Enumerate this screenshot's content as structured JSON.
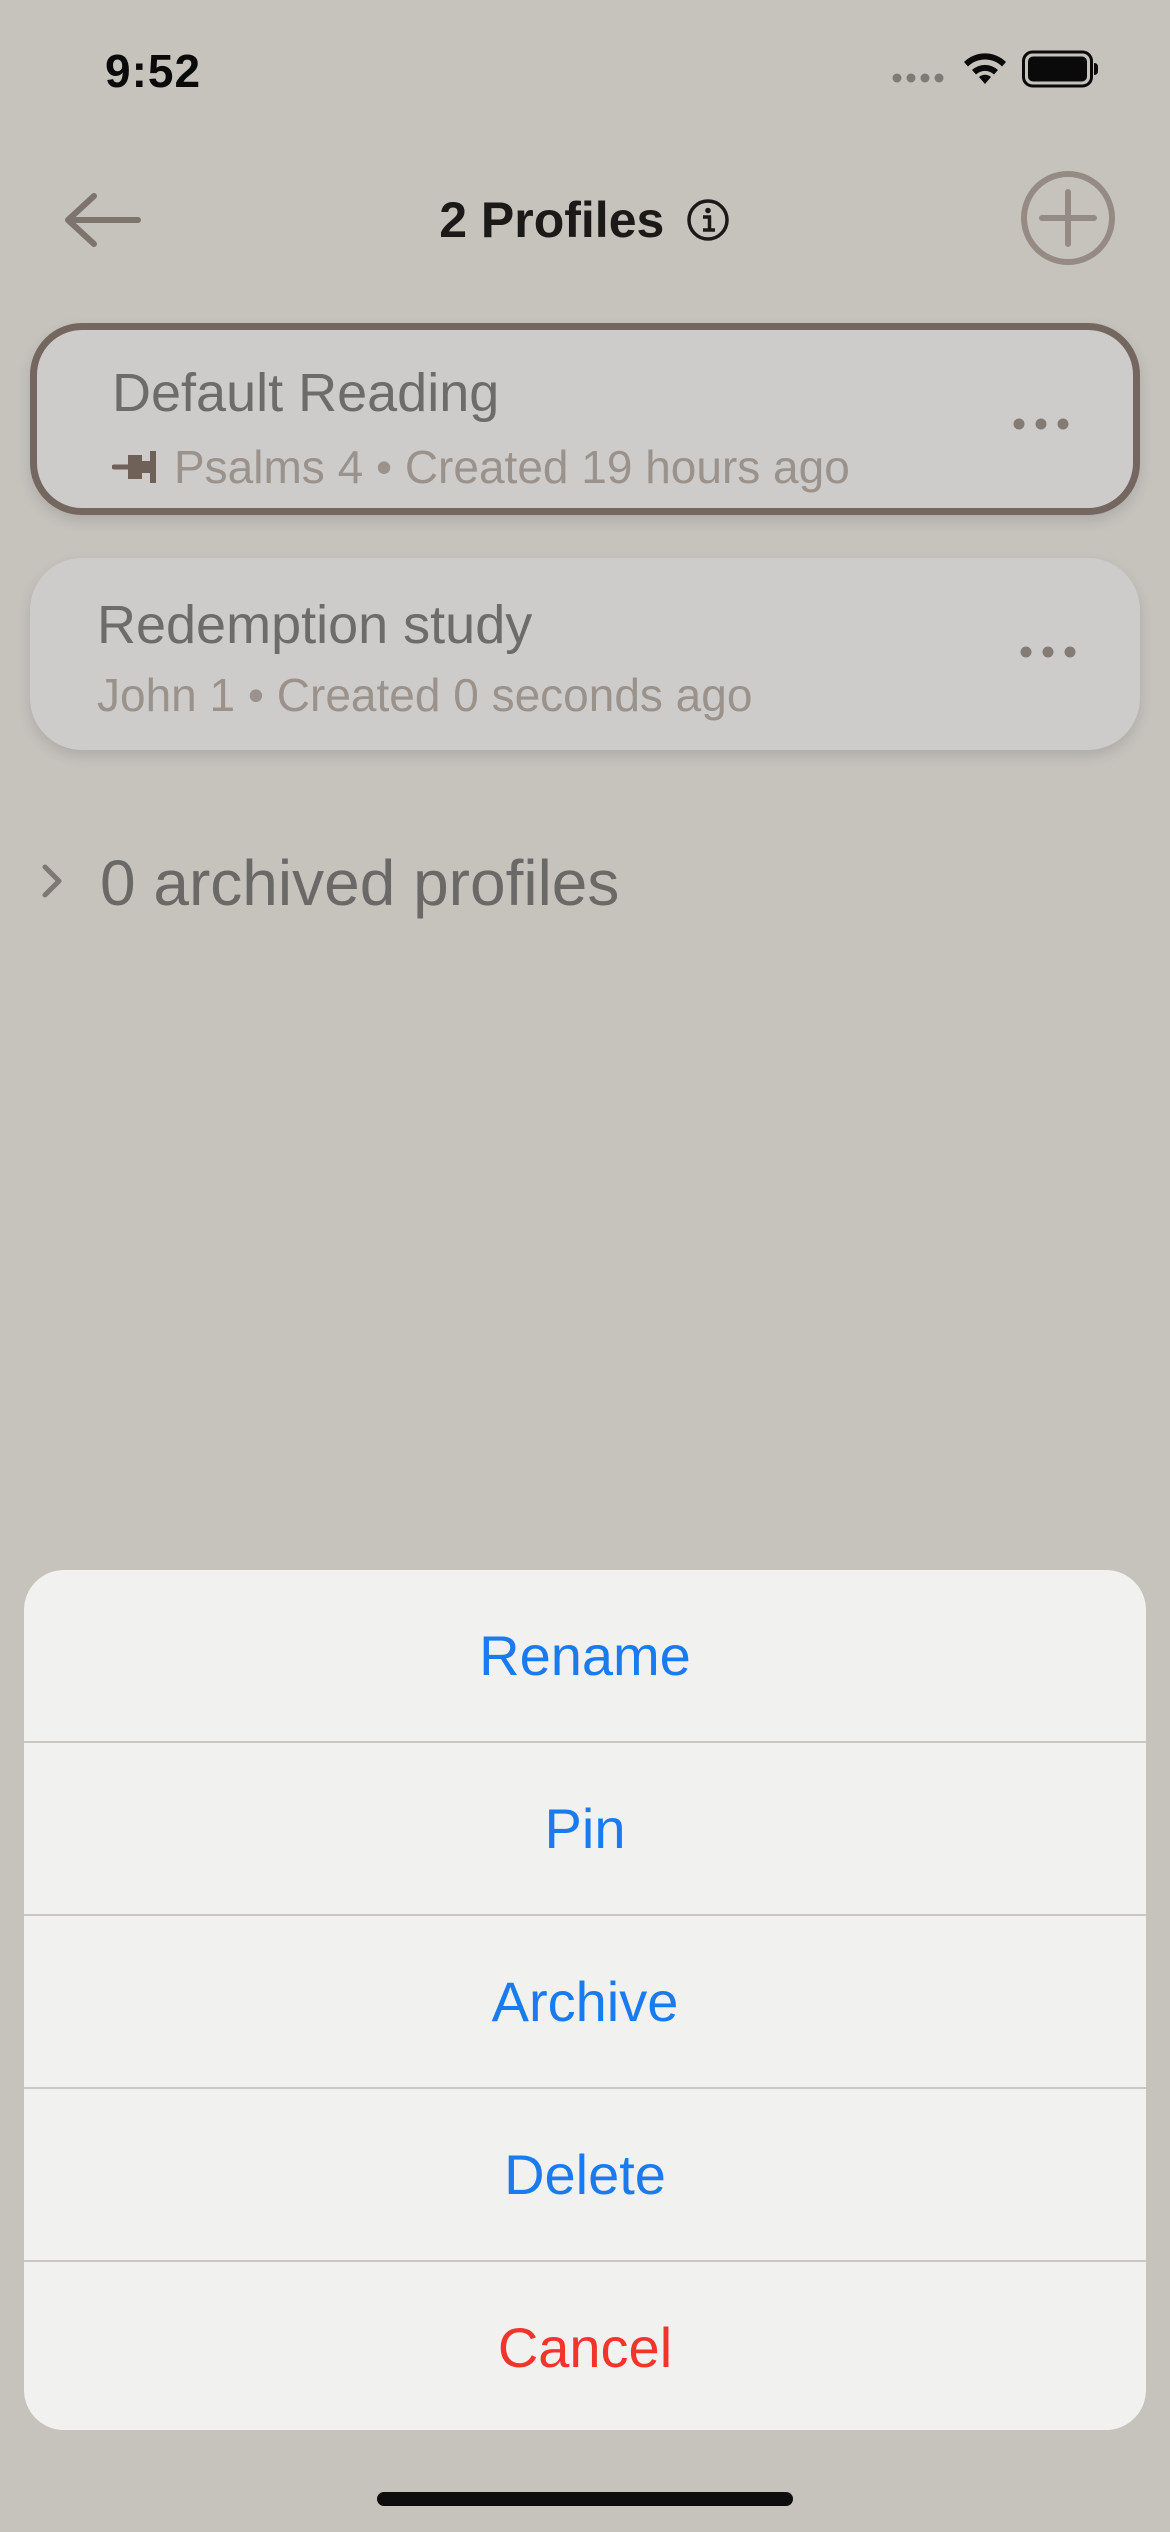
{
  "status_bar": {
    "time": "9:52",
    "icons": [
      "cellular-signal-icon",
      "wifi-icon",
      "battery-icon"
    ]
  },
  "nav": {
    "title": "2 Profiles",
    "back_icon": "back-arrow-icon",
    "info_icon": "info-icon",
    "add_icon": "add-circle-icon"
  },
  "profiles": [
    {
      "title": "Default Reading",
      "subtitle": "Psalms 4 • Created 19 hours ago",
      "pinned": true,
      "selected": true
    },
    {
      "title": "Redemption study",
      "subtitle": "John 1 • Created 0 seconds ago",
      "pinned": false,
      "selected": false
    }
  ],
  "archived": {
    "label": "0 archived profiles"
  },
  "action_sheet": {
    "items": [
      {
        "label": "Rename",
        "destructive": false
      },
      {
        "label": "Pin",
        "destructive": false
      },
      {
        "label": "Archive",
        "destructive": false
      },
      {
        "label": "Delete",
        "destructive": false
      },
      {
        "label": "Cancel",
        "destructive": true
      }
    ]
  },
  "colors": {
    "background": "#c6c3bd",
    "accent_blue": "#1a7bf0",
    "destructive_red": "#f2352c",
    "selected_border": "#74675f"
  }
}
